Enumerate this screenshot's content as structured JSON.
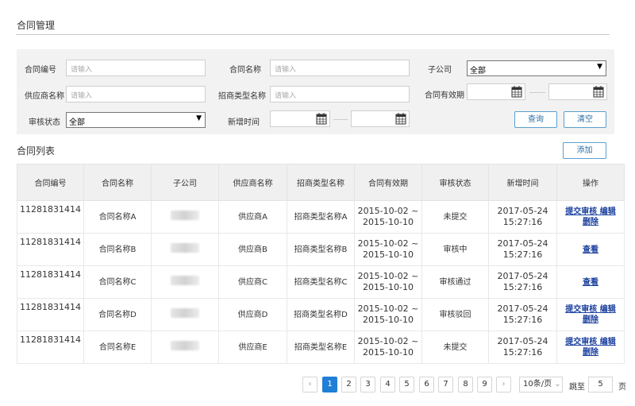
{
  "page": {
    "title": "合同管理"
  },
  "filters": {
    "contract_no": {
      "label": "合同编号",
      "placeholder": "请输入"
    },
    "contract_name": {
      "label": "合同名称",
      "placeholder": "请输入"
    },
    "subsidiary": {
      "label": "子公司",
      "value": "全部"
    },
    "supplier_name": {
      "label": "供应商名称",
      "placeholder": "请输入"
    },
    "merchant_type_name": {
      "label": "招商类型名称",
      "placeholder": "请输入"
    },
    "validity": {
      "label": "合同有效期"
    },
    "review_status": {
      "label": "审核状态",
      "value": "全部"
    },
    "created_time": {
      "label": "新增时间"
    },
    "search_button": "查询",
    "clear_button": "清空"
  },
  "list": {
    "title": "合同列表",
    "add_button": "添加",
    "columns": [
      "合同编号",
      "合同名称",
      "子公司",
      "供应商名称",
      "招商类型名称",
      "合同有效期",
      "审核状态",
      "新增时间",
      "操作"
    ],
    "rows": [
      {
        "no": "11281831414",
        "name": "合同名称A",
        "supplier": "供应商A",
        "type": "招商类型名称A",
        "validity_start": "2015-10-02 ~",
        "validity_end": "2015-10-10",
        "status": "未提交",
        "date": "2017-05-24",
        "time": "15:27:16",
        "ops_line1": "提交审核 编辑",
        "ops_line2": "删除"
      },
      {
        "no": "11281831414",
        "name": "合同名称B",
        "supplier": "供应商B",
        "type": "招商类型名称B",
        "validity_start": "2015-10-02 ~",
        "validity_end": "2015-10-10",
        "status": "审核中",
        "date": "2017-05-24",
        "time": "15:27:16",
        "ops_line1": "查看",
        "ops_line2": ""
      },
      {
        "no": "11281831414",
        "name": "合同名称C",
        "supplier": "供应商C",
        "type": "招商类型名称C",
        "validity_start": "2015-10-02 ~",
        "validity_end": "2015-10-10",
        "status": "审核通过",
        "date": "2017-05-24",
        "time": "15:27:16",
        "ops_line1": "查看",
        "ops_line2": ""
      },
      {
        "no": "11281831414",
        "name": "合同名称D",
        "supplier": "供应商D",
        "type": "招商类型名称D",
        "validity_start": "2015-10-02 ~",
        "validity_end": "2015-10-10",
        "status": "审核驳回",
        "date": "2017-05-24",
        "time": "15:27:16",
        "ops_line1": "提交审核 编辑",
        "ops_line2": "删除"
      },
      {
        "no": "11281831414",
        "name": "合同名称E",
        "supplier": "供应商E",
        "type": "招商类型名称E",
        "validity_start": "2015-10-02 ~",
        "validity_end": "2015-10-10",
        "status": "未提交",
        "date": "2017-05-24",
        "time": "15:27:16",
        "ops_line1": "提交审核 编辑",
        "ops_line2": "删除"
      }
    ]
  },
  "pagination": {
    "prev": "‹",
    "next": "›",
    "pages": [
      "1",
      "2",
      "3",
      "4",
      "5",
      "6",
      "7",
      "8",
      "9"
    ],
    "current": "1",
    "page_size": "10条/页",
    "jump_prefix": "跳至",
    "jump_value": "5",
    "jump_suffix": "页"
  },
  "colors": {
    "accent": "#1f7fd6",
    "link": "#1a3f9e",
    "panel": "#f2f2f2"
  }
}
